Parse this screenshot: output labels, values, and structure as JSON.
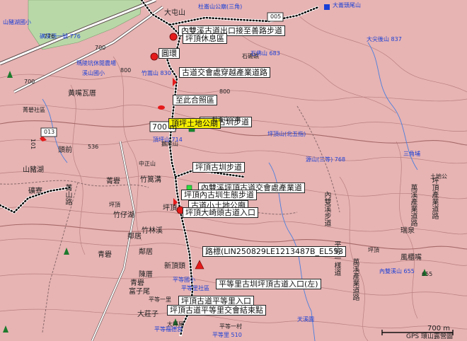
{
  "route_labels": [
    "內雙溪古道出口接至善路步道",
    "坪頂休息區",
    "圓環",
    "古道交會處穿越產業道路",
    "至此合照區",
    "坪頂古圳步道",
    "坪頂古圳步道",
    "內雙溪坪頂古道交會處產業道",
    "坪頂內古圳生態步道",
    "古道小土地公廟",
    "坪頂大崎頭古道入口",
    "路標(LIN250829LE1213487B_EL553",
    "平等里古圳坪頂古道入口(左)",
    "坪頂古道平等里入口",
    "坪頂古道平等里交會結束點"
  ],
  "place_names": [
    "大屯山",
    "杜崙山公廟",
    "黃嘴瓦厝",
    "菁礐社區",
    "頭前",
    "山豬湖",
    "礦寮",
    "菁山路",
    "竹篙溝",
    "菁礐",
    "竹仔湖",
    "坪頂",
    "竹林溪",
    "鄰居",
    "青礐",
    "青礐",
    "鄰居",
    "坪頂",
    "新頂頭",
    "陳厝",
    "富子尾",
    "大莊子",
    "大坪尾",
    "中正山",
    "鵝尾山",
    "石硼礁",
    "土地公",
    "瑞泉",
    "風櫃嘴",
    "坪頂",
    "萬溪產業道路",
    "內雙溪步道",
    "坪頂產業道路",
    "萬溪產業道路",
    "平等一樣道",
    "平等一里",
    "平等一村"
  ],
  "blue_labels": [
    "杜崙山公廟(三角)",
    "大尖後山 837",
    "大崙頭尾山",
    "瑪陵坑休閒農場",
    "溪山國小",
    "山豬湖國小",
    "磺溪頭一號 776",
    "竹嵩山 830",
    "石佛山 683",
    "坪頂山(北五指)",
    "源山(三等) 768",
    "三角埔",
    "頂坪山 714",
    "平等國小",
    "平等里社區",
    "平等福德宮",
    "天溪園",
    "內雙溪山 655",
    "平等里 510"
  ],
  "elevation_labels": [
    "776",
    "700",
    "800",
    "700",
    "536",
    "800",
    "655",
    "700 m"
  ],
  "road_signs": [
    "005",
    "013",
    "101"
  ],
  "yellow_label": "頂坪土地公廟",
  "scale_labels": {
    "top": "700 m",
    "bottom": "700 m",
    "credit": "GPS 環山露營圖"
  },
  "colors": {
    "land": "#e7b3b3",
    "forest": "#b9d8a8",
    "route": "#ffffff",
    "route_dot": "#000000",
    "poi_red": "#e51a1a",
    "poi_blue": "#1a3fd6",
    "label_bg": "#ffffff",
    "highlight": "#f7f000"
  }
}
